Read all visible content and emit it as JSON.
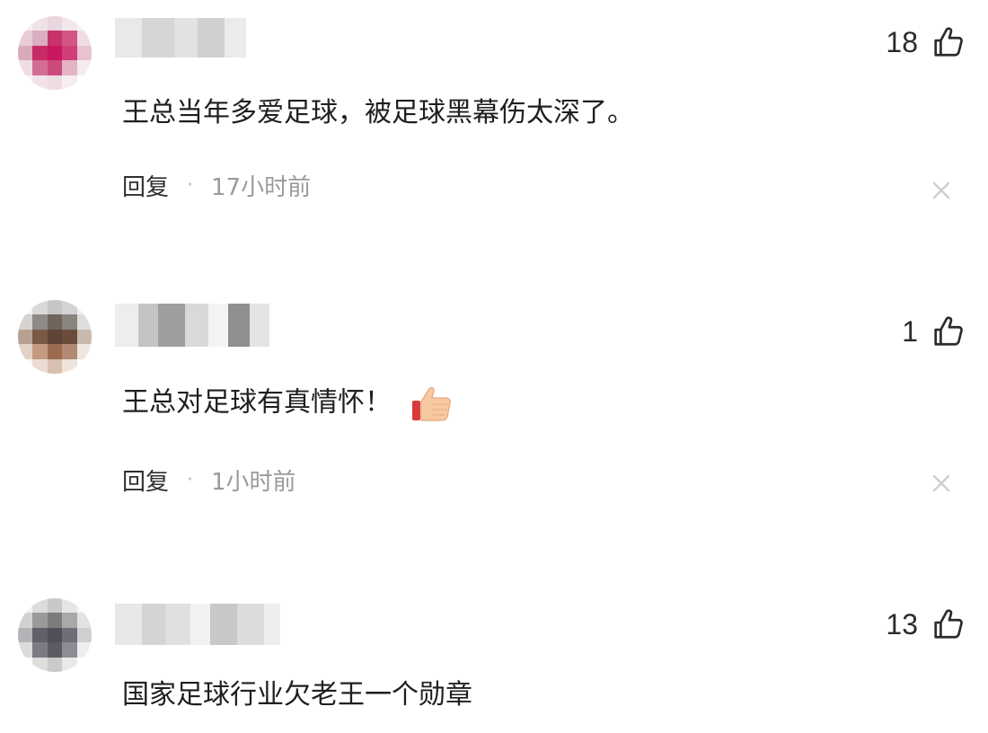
{
  "comments": [
    {
      "text": "王总当年多爱足球，被足球黑幕伤太深了。",
      "likes": "18",
      "reply_label": "回复",
      "separator": "·",
      "time": "17小时前"
    },
    {
      "text": "王总对足球有真情怀！",
      "likes": "1",
      "reply_label": "回复",
      "separator": "·",
      "time": "1小时前",
      "emoji": "thumbs-up-emoji"
    },
    {
      "text": "国家足球行业欠老王一个勋章",
      "likes": "13"
    }
  ],
  "icons": {
    "like": "thumb-up-outline-icon",
    "close": "close-icon"
  },
  "colors": {
    "text": "#1f1f1f",
    "meta": "#9a9a9a",
    "separator": "#b8b8b8"
  }
}
